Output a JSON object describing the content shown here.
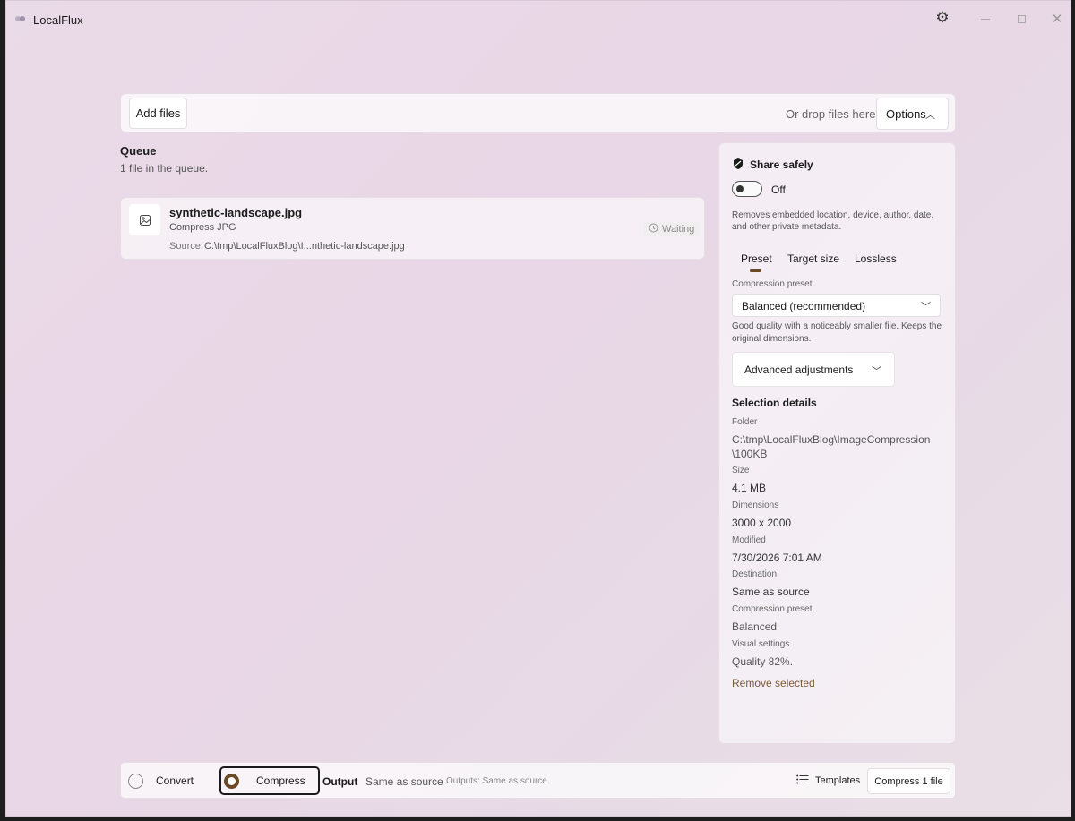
{
  "app": {
    "title": "LocalFlux"
  },
  "filebar": {
    "add_files": "Add files",
    "drop_hint": "Or drop files here",
    "options": "Options"
  },
  "queue": {
    "title": "Queue",
    "count_text": "1 file in the queue.",
    "items": [
      {
        "name": "synthetic-landscape.jpg",
        "action": "Compress JPG",
        "source_label": "Source:",
        "source": "C:\\tmp\\LocalFluxBlog\\I...nthetic-landscape.jpg",
        "status": "Waiting"
      }
    ]
  },
  "panel": {
    "share_title": "Share safely",
    "toggle_label": "Off",
    "toggle_on": false,
    "share_desc": "Removes embedded location, device, author, date, and other private metadata.",
    "tabs": [
      "Preset",
      "Target size",
      "Lossless"
    ],
    "active_tab": "Preset",
    "compression_preset_label": "Compression preset",
    "compression_preset_value": "Balanced (recommended)",
    "preset_desc": "Good quality with a noticeably smaller file. Keeps the original dimensions.",
    "advanced_label": "Advanced adjustments",
    "selection_title": "Selection details",
    "details": {
      "folder_label": "Folder",
      "folder_value": "C:\\tmp\\LocalFluxBlog\\ImageCompression \\100KB",
      "size_label": "Size",
      "size_value": "4.1 MB",
      "dimensions_label": "Dimensions",
      "dimensions_value": "3000 x 2000",
      "modified_label": "Modified",
      "modified_value": "7/30/2026 7:01 AM",
      "destination_label": "Destination",
      "destination_value": "Same as source",
      "preset_label": "Compression preset",
      "preset_value": "Balanced",
      "visual_label": "Visual settings",
      "visual_value": "Quality 82%."
    },
    "remove_selected": "Remove selected"
  },
  "bottombar": {
    "convert": "Convert",
    "compress": "Compress",
    "selected_mode": "Compress",
    "output_label": "Output",
    "output_value": "Same as source",
    "outputs_summary": "Outputs: Same as source",
    "templates": "Templates",
    "compress_button": "Compress 1 file"
  },
  "colors": {
    "accent": "#6d4a26",
    "background": "#e9d6e6"
  }
}
